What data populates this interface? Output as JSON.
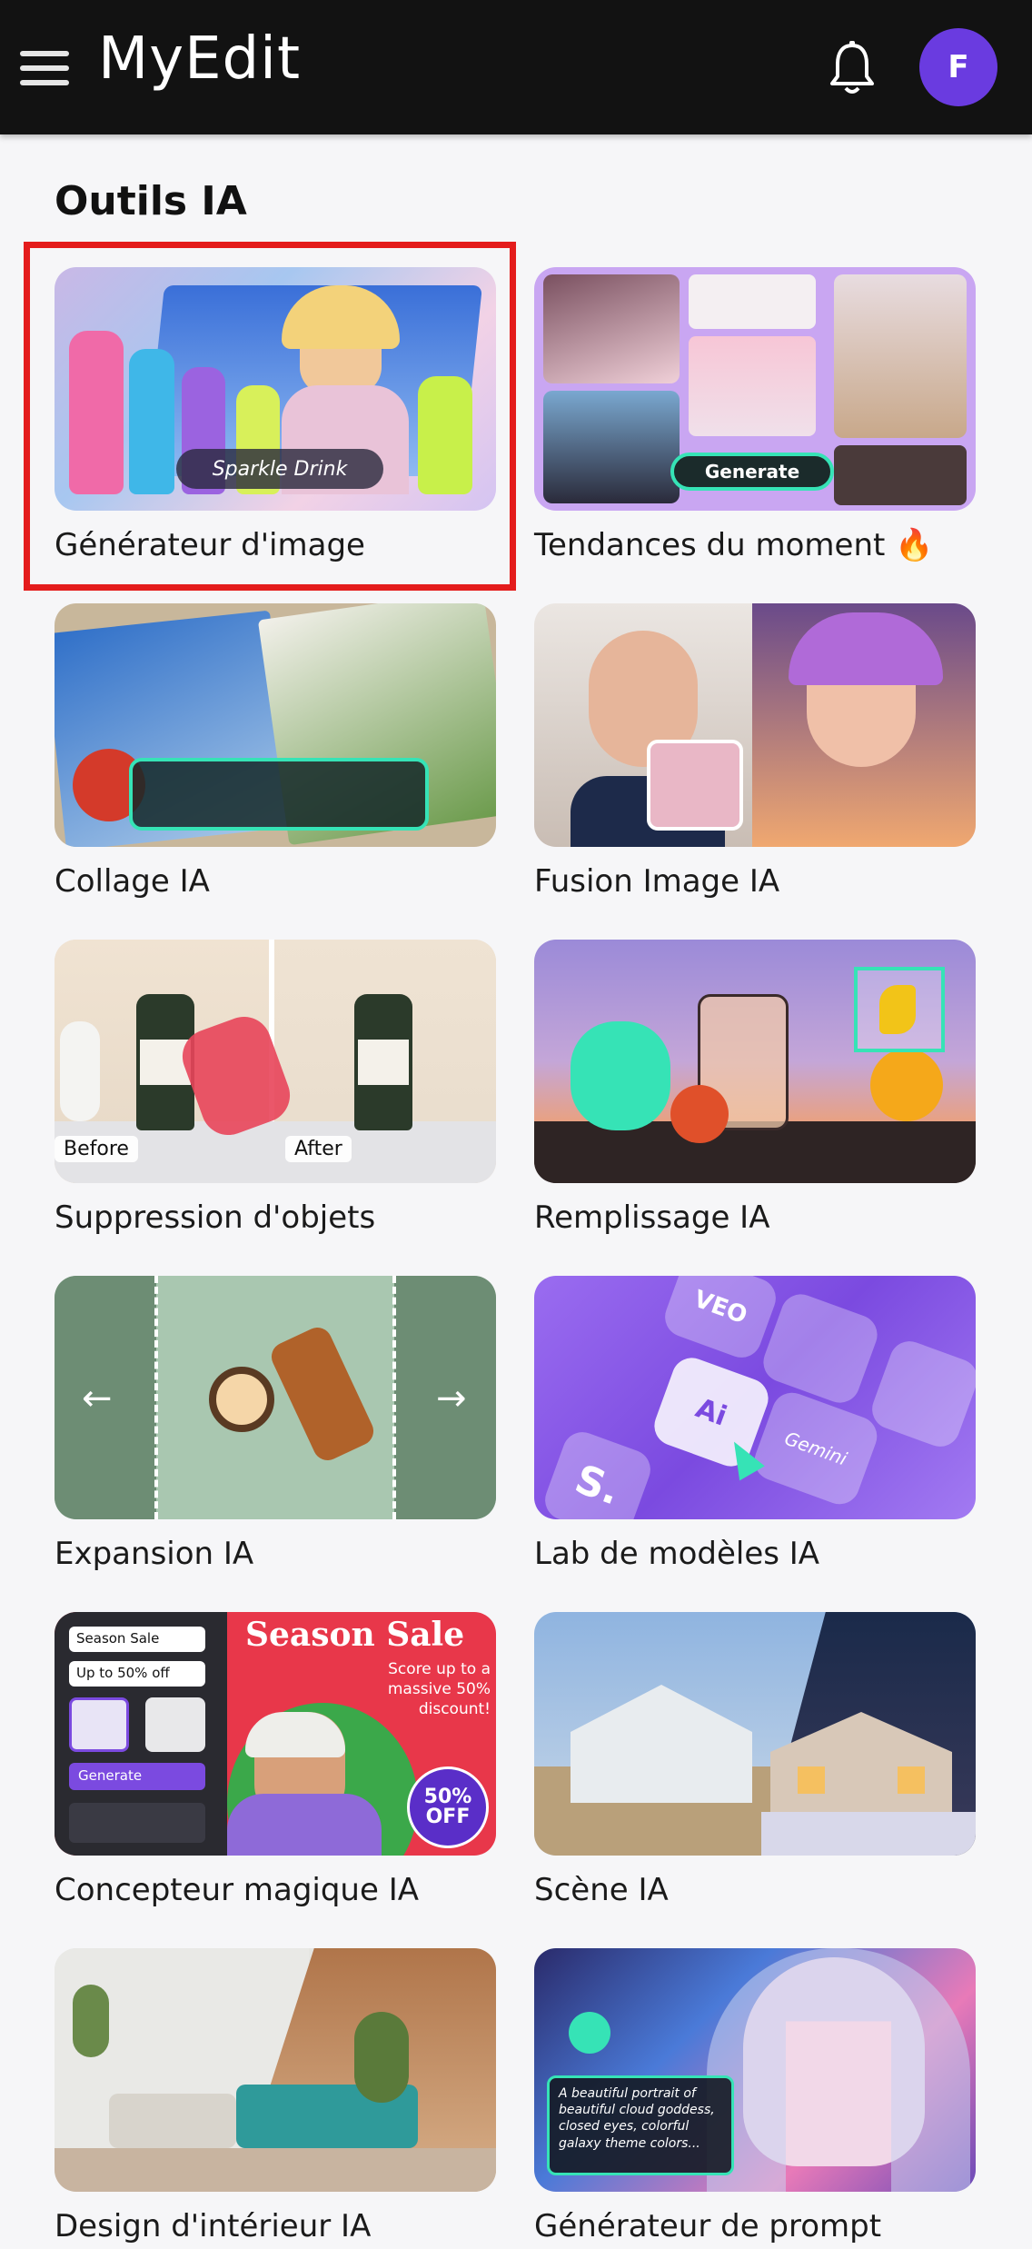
{
  "app": {
    "title": "MyEdit",
    "avatar_initial": "F"
  },
  "section": {
    "title": "Outils IA"
  },
  "tools": [
    {
      "label": "Générateur d'image",
      "badge": "Sparkle Drink"
    },
    {
      "label": "Tendances du moment 🔥",
      "button": "Generate"
    },
    {
      "label": "Collage IA"
    },
    {
      "label": "Fusion Image IA"
    },
    {
      "label": "Suppression d'objets",
      "before": "Before",
      "after": "After"
    },
    {
      "label": "Remplissage IA"
    },
    {
      "label": "Expansion IA"
    },
    {
      "label": "Lab de modèles IA",
      "chips": [
        "VEO",
        "Ai",
        "Gemini",
        "S."
      ]
    },
    {
      "label": "Concepteur magique IA",
      "panel": [
        "Season Sale",
        "Up to 50% off",
        "Generate"
      ],
      "headline": "Season Sale",
      "sub": "Score up to a massive 50% discount!",
      "badge": "50% OFF"
    },
    {
      "label": "Scène IA"
    },
    {
      "label": "Design d'intérieur IA"
    },
    {
      "label": "Générateur de prompt",
      "prompt": "A beautiful portrait of beautiful cloud goddess, closed eyes, colorful galaxy theme colors..."
    }
  ],
  "colors": {
    "accent": "#6a3be0",
    "highlight": "#e41c1c",
    "topbar": "#121212"
  }
}
